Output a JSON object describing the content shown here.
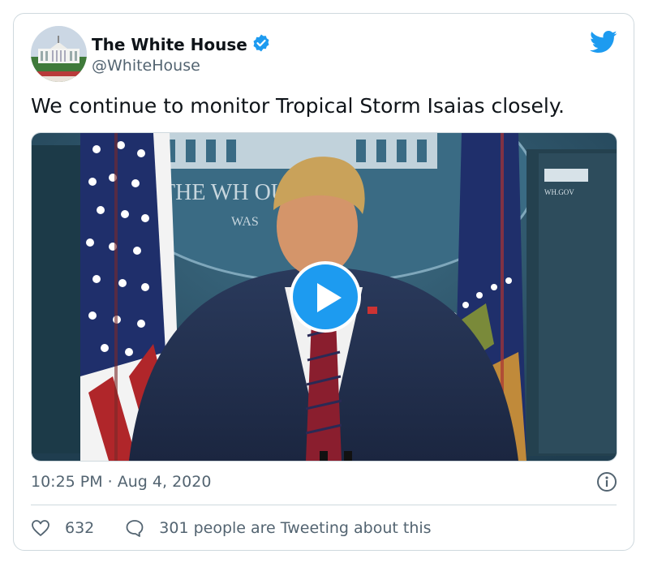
{
  "tweet": {
    "author_name": "The White House",
    "author_handle": "@WhiteHouse",
    "text": "We continue to monitor Tropical Storm Isaias closely.",
    "timestamp": "10:25 PM · Aug 4, 2020",
    "likes": "632",
    "tweeting_about": "301 people are Tweeting about this"
  },
  "media": {
    "backdrop_text": "THE WH   OUSE",
    "backdrop_subtext": "WAS",
    "monitor_text": "WH.GOV"
  },
  "icons": {
    "verified": "verified-badge-icon",
    "twitter": "twitter-bird-icon",
    "play": "play-icon",
    "info": "info-icon",
    "like": "heart-icon",
    "reply": "speech-bubble-icon"
  },
  "colors": {
    "brand": "#1d9bf0",
    "text": "#0f1419",
    "secondary_text": "#536471",
    "border": "#cfd9de"
  }
}
